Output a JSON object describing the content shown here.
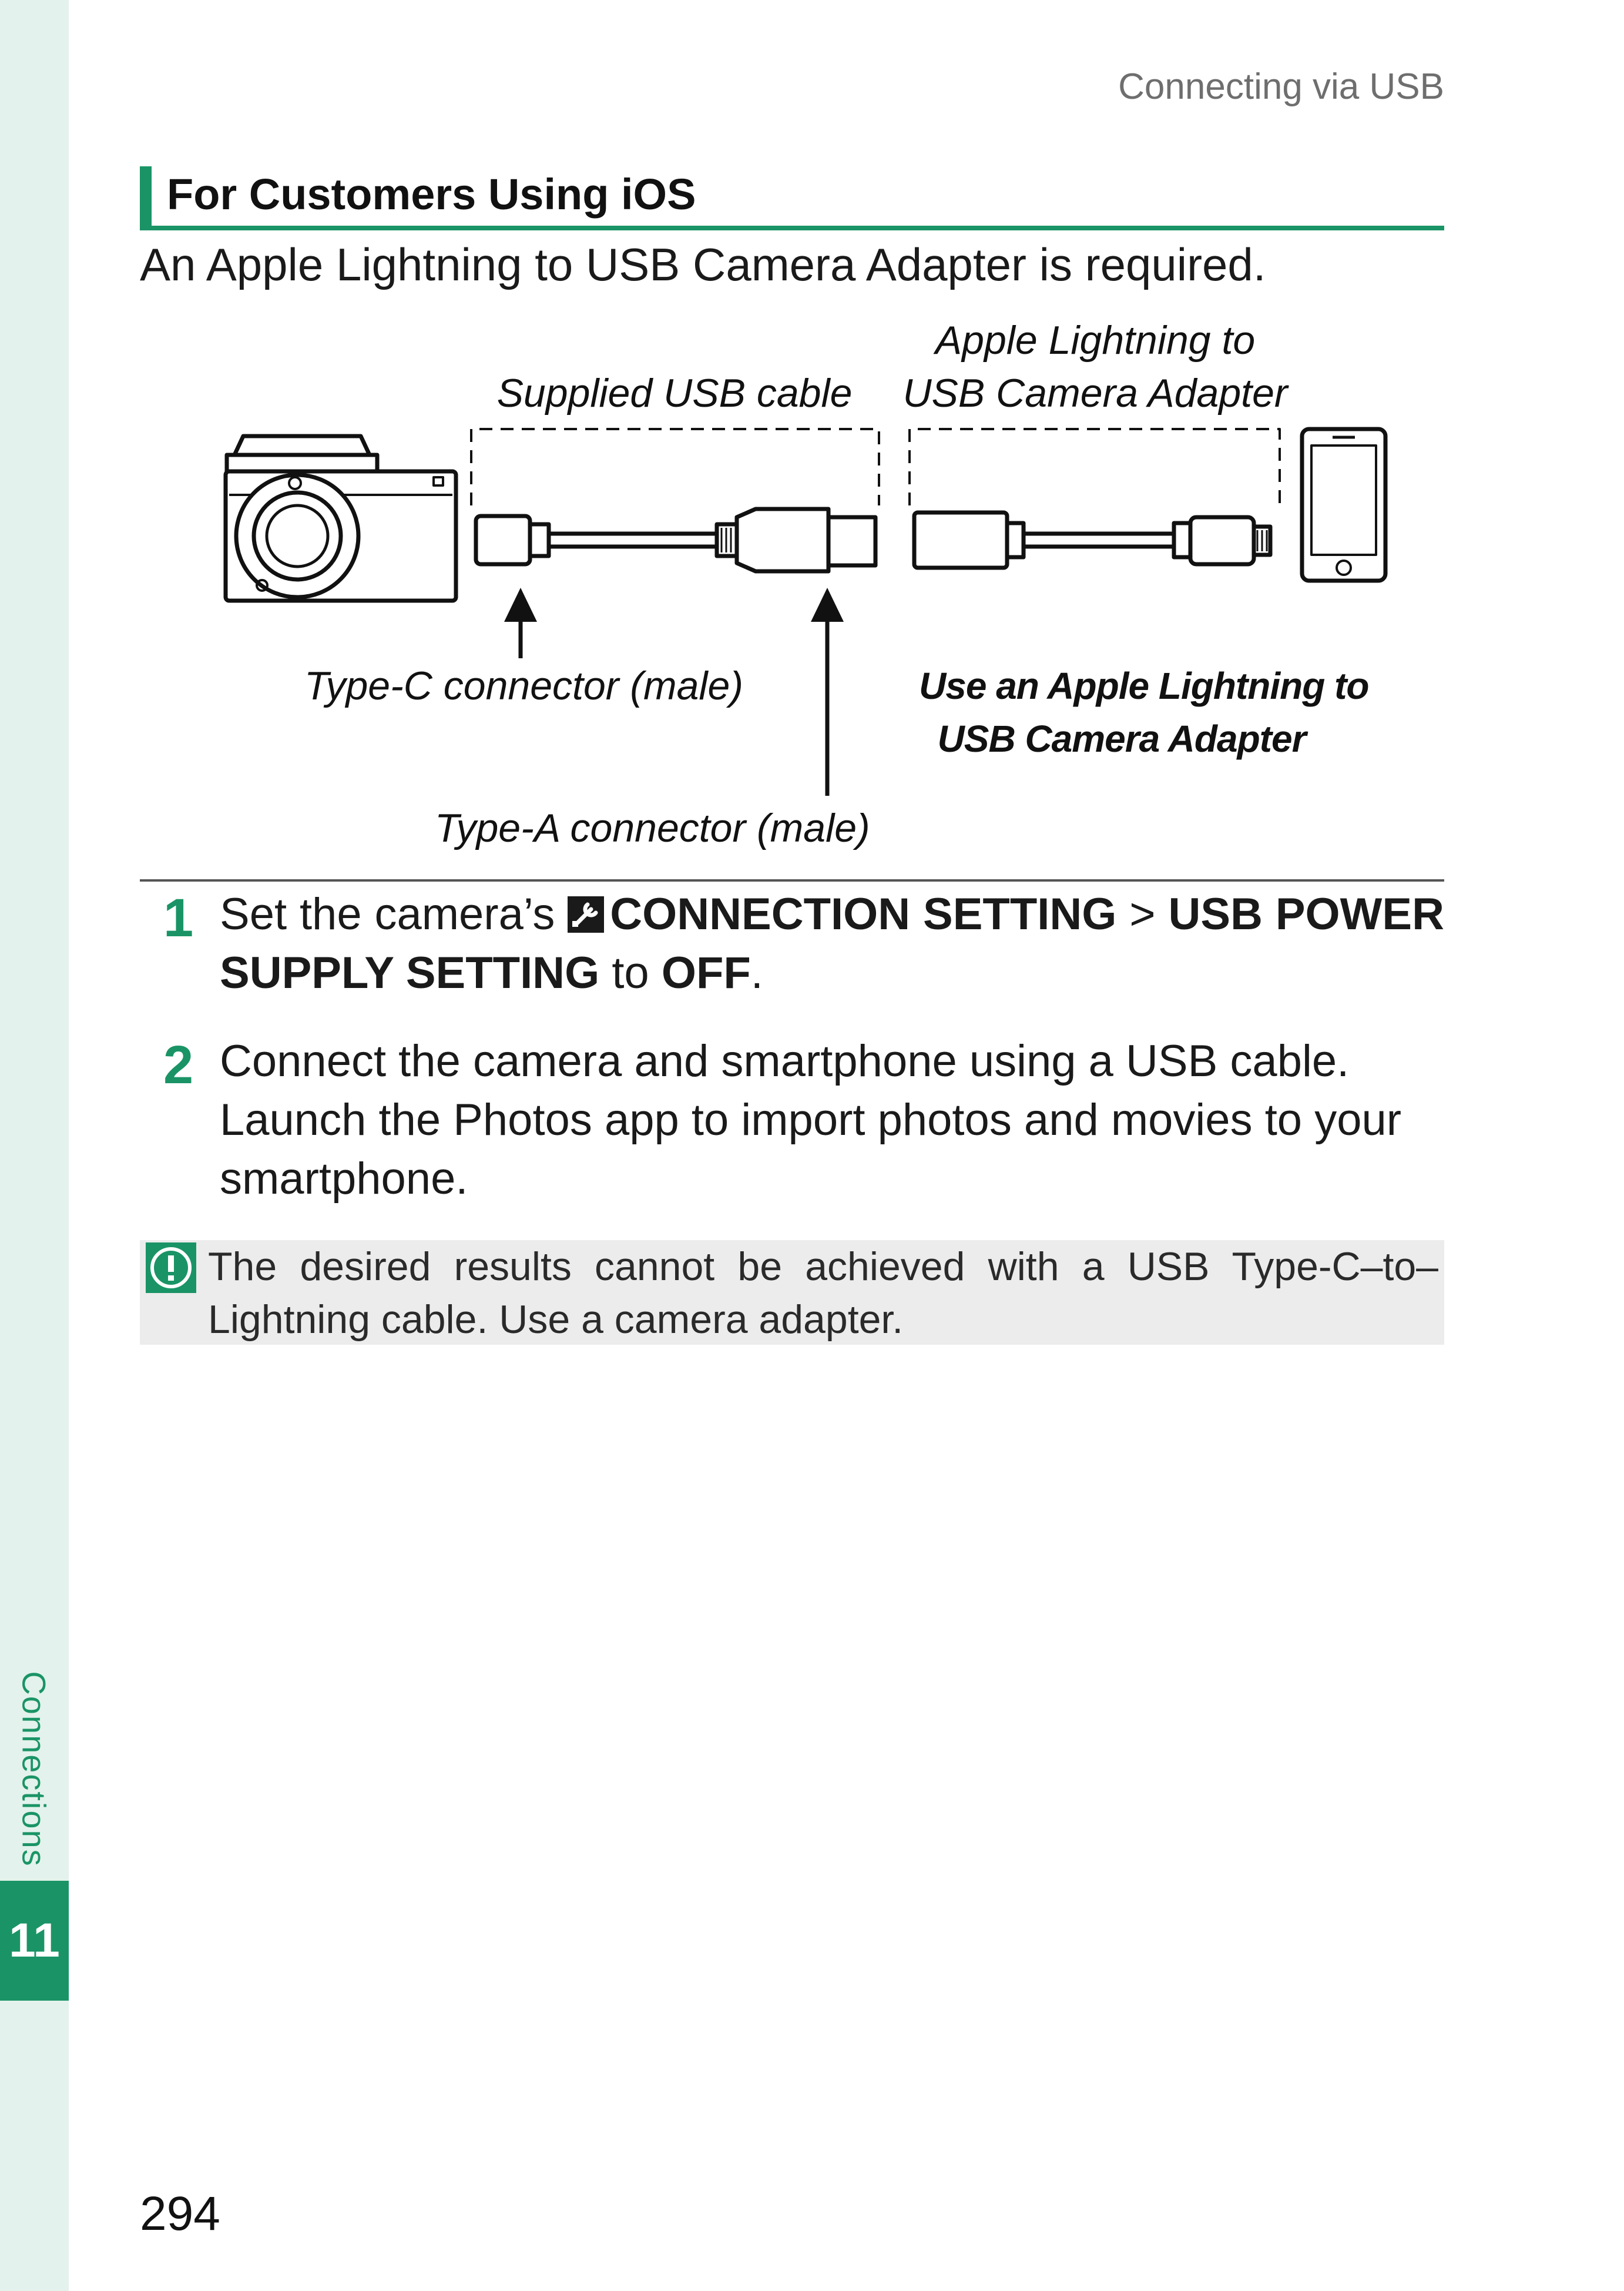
{
  "running_head": "Connecting via USB",
  "section": {
    "title": "For Customers Using iOS",
    "intro": "An Apple Lightning to USB Camera Adapter is required."
  },
  "diagram": {
    "label_supplied_cable": "Supplied USB cable",
    "label_adapter_line1": "Apple Lightning to",
    "label_adapter_line2": "USB Camera Adapter",
    "label_type_c": "Type-C connector (male)",
    "label_type_a": "Type-A connector (male)",
    "label_use_line1": "Use an Apple Lightning to",
    "label_use_line2": "USB Camera Adapter"
  },
  "steps": [
    {
      "number": "1",
      "pre": "Set the camera’s",
      "menu": "CONNECTION SETTING",
      "sep": ">",
      "item_a": "USB POWER",
      "item_b": "SUPPLY SETTING",
      "mid": "to",
      "value": "OFF",
      "end": "."
    },
    {
      "number": "2",
      "line1": "Connect the camera and smartphone using a USB cable.",
      "line2": "Launch the Photos app to import photos and movies to your",
      "line3": "smartphone."
    }
  ],
  "note": {
    "icon": "caution-icon",
    "line1": "The desired results cannot be achieved with a USB Type-C–to–",
    "line2": "Lightning cable. Use a camera adapter."
  },
  "sidebar": {
    "chapter_label": "Connections",
    "chapter_number": "11"
  },
  "page_number": "294",
  "colors": {
    "accent": "#1a9466",
    "sidebar_bg": "#e3f2ec",
    "note_bg": "#ececec"
  }
}
